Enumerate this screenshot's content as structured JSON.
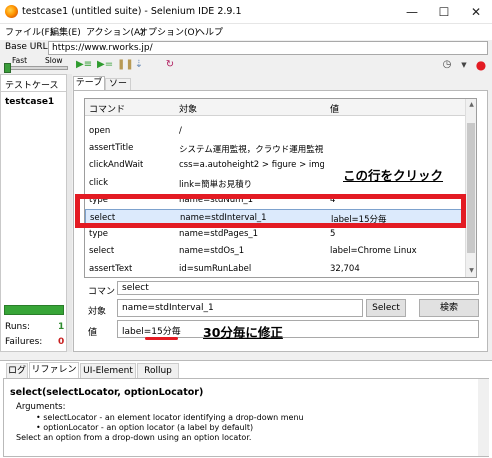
{
  "window": {
    "title": "testcase1 (untitled suite) - Selenium IDE 2.9.1",
    "minimize": "—",
    "maximize": "☐",
    "close": "✕"
  },
  "menu": [
    "ファイル(F)",
    "編集(E)",
    "アクション(A)",
    "オプション(O)",
    "ヘルプ"
  ],
  "base_url": {
    "label": "Base URL",
    "value": "https://www.rworks.jp/"
  },
  "toolbar": {
    "fast_label": "Fast",
    "slow_label": "Slow"
  },
  "left_panel": {
    "header": "テストケース",
    "testcase": "testcase1",
    "runs_label": "Runs:",
    "runs_value": "1",
    "failures_label": "Failures:",
    "failures_value": "0"
  },
  "tabs": {
    "table": "テーブル",
    "source": "ソース"
  },
  "table": {
    "headers": [
      "コマンド",
      "対象",
      "値"
    ],
    "rows": [
      {
        "command": "open",
        "target": "/",
        "value": ""
      },
      {
        "command": "assertTitle",
        "target": "システム運用監視，クラウド運用監視 |…",
        "value": ""
      },
      {
        "command": "clickAndWait",
        "target": "css=a.autoheight2 > figure > img.c…",
        "value": ""
      },
      {
        "command": "click",
        "target": "link=簡単お見積り",
        "value": ""
      },
      {
        "command": "type",
        "target": "name=stdNum_1",
        "value": "4"
      },
      {
        "command": "select",
        "target": "name=stdInterval_1",
        "value": "label=15分毎"
      },
      {
        "command": "type",
        "target": "name=stdPages_1",
        "value": "5"
      },
      {
        "command": "select",
        "target": "name=stdOs_1",
        "value": "label=Chrome Linux"
      },
      {
        "command": "assertText",
        "target": "id=sumRunLabel",
        "value": "32,704"
      }
    ]
  },
  "annotations": {
    "click_row": "この行をクリック",
    "edit_value": "30分毎に修正"
  },
  "editor": {
    "command_label": "コマンド",
    "command_value": "select",
    "target_label": "対象",
    "target_value": "name=stdInterval_1",
    "select_button": "Select",
    "find_button": "検索",
    "value_label": "値",
    "value_value": "label=15分毎"
  },
  "bottom_tabs": [
    "ログ",
    "リファレンス",
    "UI-Element",
    "Rollup"
  ],
  "reference": {
    "title": "select(selectLocator, optionLocator)",
    "args_label": "Arguments:",
    "arg1": "• selectLocator - an element locator identifying a drop-down menu",
    "arg2": "• optionLocator - an option locator (a label by default)",
    "description": "Select an option from a drop-down using an option locator."
  },
  "colors": {
    "annotation_red": "#e31b23",
    "selected_row": "#dceafc",
    "progress_green": "#37a537"
  }
}
